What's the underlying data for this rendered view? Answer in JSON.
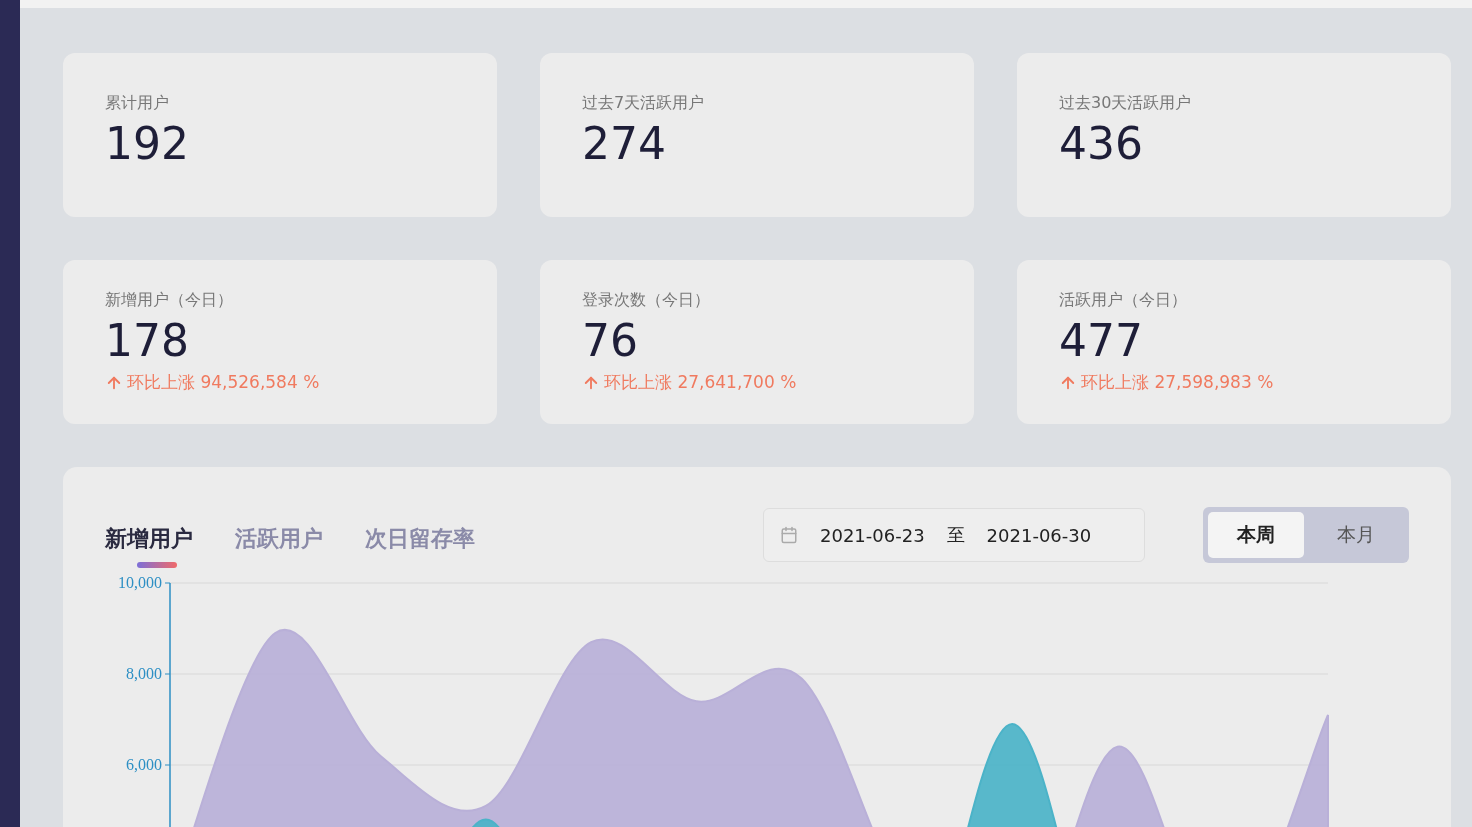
{
  "stats": [
    {
      "label": "累计用户",
      "value": "192"
    },
    {
      "label": "过去7天活跃用户",
      "value": "274"
    },
    {
      "label": "过去30天活跃用户",
      "value": "436"
    },
    {
      "label": "新增用户（今日）",
      "value": "178",
      "trend": "环比上涨 94,526,584 %"
    },
    {
      "label": "登录次数（今日）",
      "value": "76",
      "trend": "环比上涨 27,641,700 %"
    },
    {
      "label": "活跃用户（今日）",
      "value": "477",
      "trend": "环比上涨 27,598,983 %"
    }
  ],
  "chart_panel": {
    "tabs": [
      {
        "label": "新增用户",
        "selected": true
      },
      {
        "label": "活跃用户",
        "selected": false
      },
      {
        "label": "次日留存率",
        "selected": false
      }
    ],
    "date_range": {
      "start": "2021-06-23",
      "separator": "至",
      "end": "2021-06-30"
    },
    "period_toggle": [
      {
        "label": "本周",
        "selected": true
      },
      {
        "label": "本月",
        "selected": false
      }
    ],
    "chart_data": {
      "type": "area",
      "ylim": [
        0,
        10000
      ],
      "yticks": [
        {
          "value": 6000,
          "label": "6,000"
        },
        {
          "value": 8000,
          "label": "8,000"
        },
        {
          "value": 10000,
          "label": "10,000"
        }
      ],
      "series": [
        {
          "color": "#b9b0d8",
          "values": [
            3000,
            8900,
            6200,
            5100,
            8700,
            7400,
            7900,
            3000,
            1000,
            6400,
            2000,
            7100
          ]
        },
        {
          "color": "#4bb3c8",
          "values": [
            0,
            0,
            0,
            4800,
            0,
            0,
            0,
            0,
            6900,
            0,
            0,
            0
          ]
        }
      ]
    }
  }
}
